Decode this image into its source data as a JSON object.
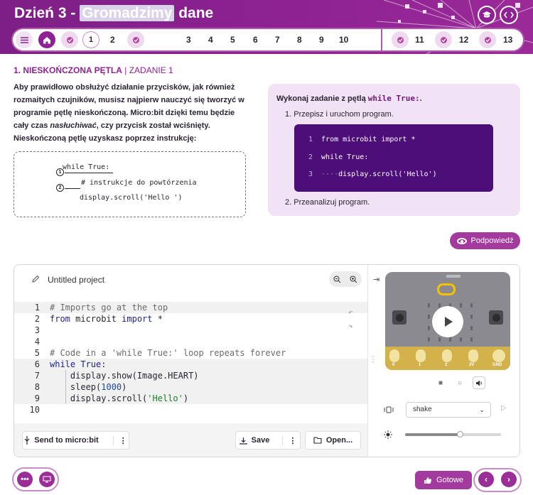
{
  "header": {
    "title_prefix": "Dzień 3 - ",
    "title_highlight": "Gromadzimy",
    "title_suffix": " dane",
    "icon_right_1": "graduation-cap-icon",
    "icon_right_2": "code-icon"
  },
  "nav": {
    "numbers": [
      "1",
      "2",
      "3",
      "4",
      "5",
      "6",
      "7",
      "8",
      "9",
      "10",
      "11",
      "12",
      "13"
    ],
    "menu_icon": "menu-icon",
    "home_icon": "home-icon",
    "badge_icon": "badge-icon"
  },
  "task": {
    "heading": "1. NIESKOŃCZONA PĘTLA",
    "heading_sep": " | ",
    "heading_sub": "ZADANIE 1",
    "desc_1": "Aby prawidłowo obsłużyć działanie przycisków, jak również rozmaitych czujników, musisz najpierw nauczyć się tworzyć w programie pętlę nieskończoną. Micro:bit dzięki temu będzie cały czas ",
    "desc_em": "nasłuchiwać",
    "desc_2": ", czy przycisk został wciśnięty. Nieskończoną pętlę uzyskasz poprzez instrukcję:",
    "code_line_1": "while True:",
    "code_line_2": "# instrukcje do powtórzenia",
    "code_line_3": "display.scroll('Hello ')",
    "marker_1": "1",
    "marker_2": "2"
  },
  "exercise": {
    "lead_text": "Wykonaj zadanie z pętlą ",
    "lead_code": "while True:",
    "lead_end": ".",
    "step_1": "1. Przepisz i uruchom program.",
    "step_2": "2. Przeanalizuj program.",
    "code": [
      {
        "num": "1",
        "dots": "",
        "text": "from microbit import *"
      },
      {
        "num": "2",
        "dots": "",
        "text": "while True:"
      },
      {
        "num": "3",
        "dots": "····",
        "text": "display.scroll('Hello')"
      }
    ]
  },
  "hint": {
    "label": "Podpowiedź",
    "icon": "eye-icon"
  },
  "editor": {
    "project_name": "Untitled project",
    "lines": [
      {
        "num": "1",
        "code": "# Imports go at the top"
      },
      {
        "num": "2",
        "code": "from microbit import *"
      },
      {
        "num": "3",
        "code": ""
      },
      {
        "num": "4",
        "code": ""
      },
      {
        "num": "5",
        "code": "# Code in a 'while True:' loop repeats forever"
      },
      {
        "num": "6",
        "code": "while True:"
      },
      {
        "num": "7",
        "code": "    display.show(Image.HEART)"
      },
      {
        "num": "8",
        "code": "    sleep(1000)"
      },
      {
        "num": "9",
        "code": "    display.scroll('Hello')"
      },
      {
        "num": "10",
        "code": ""
      }
    ],
    "send_label": "Send to micro:bit",
    "save_label": "Save",
    "open_label": "Open..."
  },
  "simulator": {
    "pins": [
      "0",
      "1",
      "2",
      "3V",
      "GND"
    ],
    "gesture": "shake",
    "light_level": 0.57
  },
  "footer": {
    "done_label": "Gotowe"
  },
  "colors": {
    "brand": "#8e2292",
    "accent": "#a33a9d",
    "code_bg": "#4c0f78",
    "panel_bg": "#f2e2f5"
  }
}
